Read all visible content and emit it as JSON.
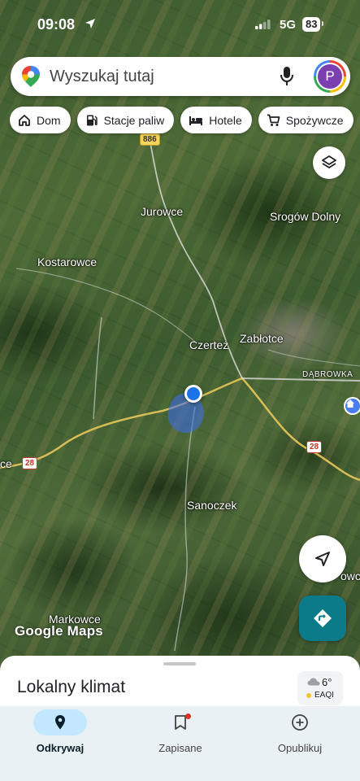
{
  "status_bar": {
    "time": "09:08",
    "network": "5G",
    "battery": "83"
  },
  "search": {
    "placeholder": "Wyszukaj tutaj",
    "avatar_letter": "P"
  },
  "chips": [
    {
      "label": "Dom",
      "icon": "home-icon"
    },
    {
      "label": "Stacje paliw",
      "icon": "gas-station-icon"
    },
    {
      "label": "Hotele",
      "icon": "bed-icon"
    },
    {
      "label": "Spożywcze",
      "icon": "cart-icon"
    }
  ],
  "map": {
    "places": [
      "Jurowce",
      "Srogów Dolny",
      "Kostarowce",
      "Czerteż",
      "Zabłotce",
      "DĄBROWKA",
      "Sanoczek",
      "Markowce",
      "ce",
      "owce"
    ],
    "road_shields": [
      "886",
      "28",
      "28"
    ],
    "logo": "Google Maps"
  },
  "sheet": {
    "title": "Lokalny klimat",
    "weather": {
      "temp": "6°",
      "aqi": "EAQI"
    }
  },
  "nav": [
    {
      "label": "Odkrywaj",
      "icon": "explore-pin-icon",
      "active": true
    },
    {
      "label": "Zapisane",
      "icon": "bookmark-icon",
      "active": false
    },
    {
      "label": "Opublikuj",
      "icon": "add-circle-icon",
      "active": false
    }
  ],
  "colors": {
    "accent": "#1a73e8",
    "directions": "#0b7b8a",
    "nav_bg": "#eaf1f5",
    "active_pill": "#c2e7ff"
  }
}
